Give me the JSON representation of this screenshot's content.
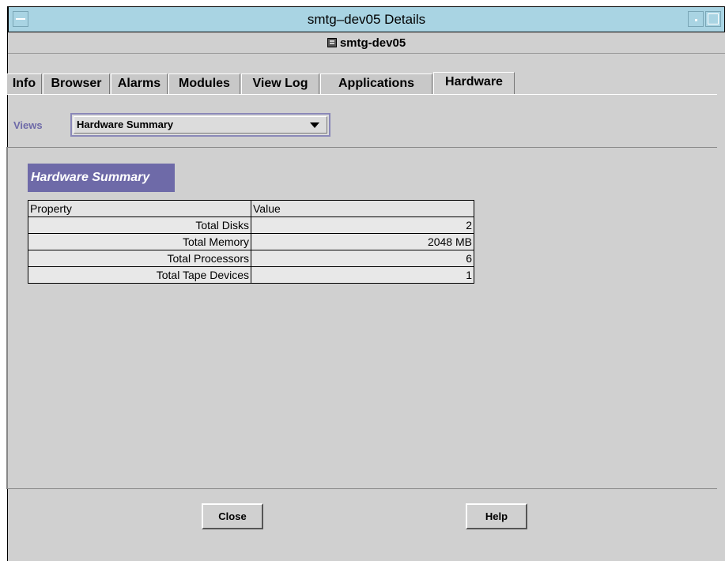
{
  "window": {
    "title": "smtg–dev05 Details"
  },
  "host": {
    "name": "smtg-dev05"
  },
  "tabs": [
    {
      "label": "Info",
      "active": false
    },
    {
      "label": "Browser",
      "active": false
    },
    {
      "label": "Alarms",
      "active": false
    },
    {
      "label": "Modules",
      "active": false
    },
    {
      "label": "View Log",
      "active": false
    },
    {
      "label": "Applications",
      "active": false
    },
    {
      "label": "Hardware",
      "active": true
    }
  ],
  "views": {
    "label": "Views",
    "selected": "Hardware Summary"
  },
  "section": {
    "title": "Hardware Summary"
  },
  "table": {
    "headers": [
      "Property",
      "Value"
    ],
    "rows": [
      [
        "Total Disks",
        "2"
      ],
      [
        "Total Memory",
        "2048 MB"
      ],
      [
        "Total Processors",
        "6"
      ],
      [
        "Total Tape Devices",
        "1"
      ]
    ]
  },
  "buttons": {
    "close": "Close",
    "help": "Help"
  },
  "colors": {
    "titlebar": "#a9d4e3",
    "accent": "#6e6aa8",
    "background": "#d0d0d0"
  },
  "icons": {
    "host": "server-icon"
  }
}
